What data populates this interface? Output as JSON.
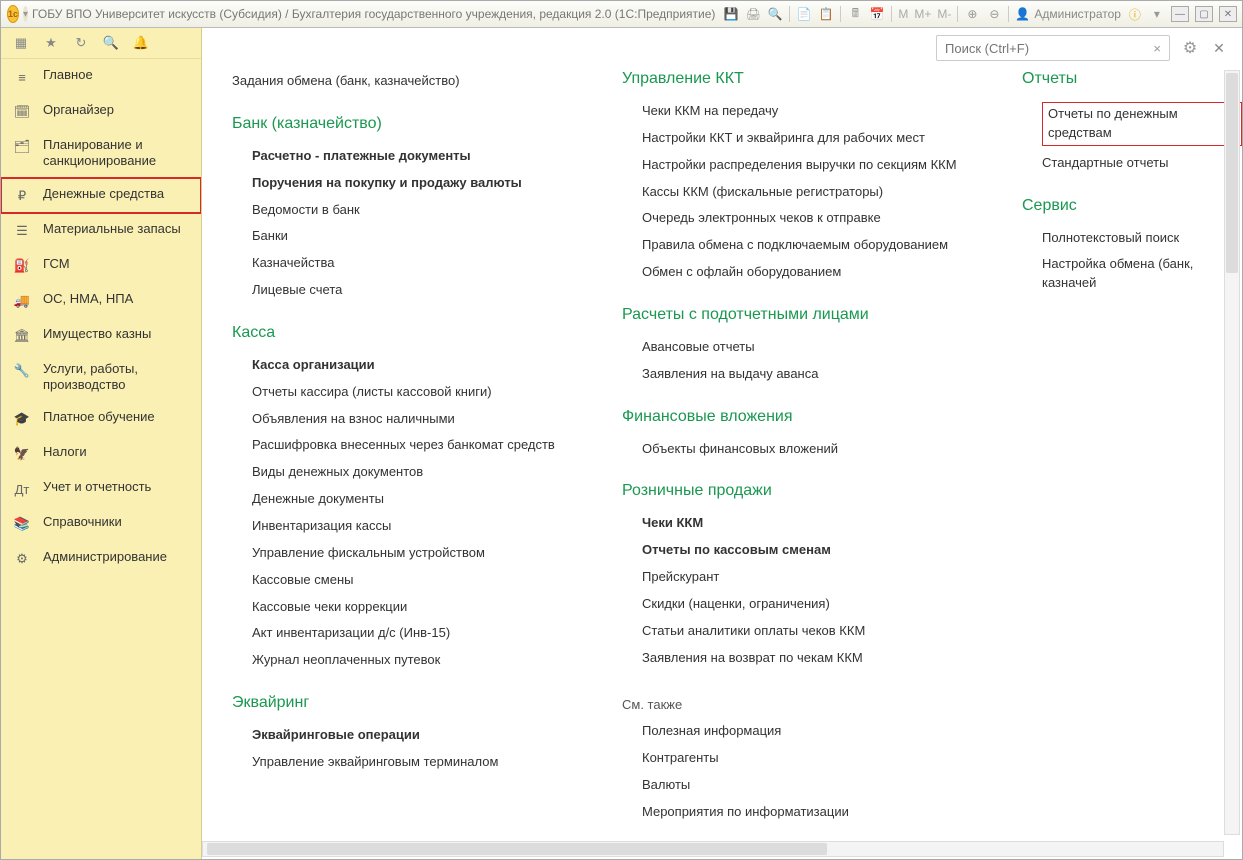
{
  "titlebar": {
    "title": "ГОБУ ВПО Университет искусств (Субсидия) / Бухгалтерия государственного учреждения, редакция 2.0  (1С:Предприятие)",
    "m": "M",
    "m_plus": "M+",
    "m_minus": "M-",
    "user_label": "Администратор"
  },
  "search": {
    "placeholder": "Поиск (Ctrl+F)"
  },
  "sidebar": {
    "items": [
      {
        "icon": "≡",
        "label": "Главное"
      },
      {
        "icon": "🗓",
        "label": "Органайзер"
      },
      {
        "icon": "🗂",
        "label": "Планирование и санкционирование"
      },
      {
        "icon": "₽",
        "label": "Денежные средства",
        "active": true
      },
      {
        "icon": "☰",
        "label": "Материальные запасы"
      },
      {
        "icon": "⛽",
        "label": "ГСМ"
      },
      {
        "icon": "🚚",
        "label": "ОС, НМА, НПА"
      },
      {
        "icon": "🏛",
        "label": "Имущество казны"
      },
      {
        "icon": "🔧",
        "label": "Услуги, работы, производство"
      },
      {
        "icon": "🎓",
        "label": "Платное обучение"
      },
      {
        "icon": "🦅",
        "label": "Налоги"
      },
      {
        "icon": "Дт",
        "label": "Учет и отчетность"
      },
      {
        "icon": "📚",
        "label": "Справочники"
      },
      {
        "icon": "⚙",
        "label": "Администрирование"
      }
    ]
  },
  "sections": {
    "col1": [
      {
        "items": [
          {
            "t": "Задания обмена (банк, казначейство)",
            "plain": true
          }
        ]
      },
      {
        "title": "Банк (казначейство)",
        "items": [
          {
            "t": "Расчетно - платежные документы",
            "b": true
          },
          {
            "t": "Поручения на покупку и продажу валюты",
            "b": true
          },
          {
            "t": "Ведомости в банк"
          },
          {
            "t": "Банки"
          },
          {
            "t": "Казначейства"
          },
          {
            "t": "Лицевые счета"
          }
        ]
      },
      {
        "title": "Касса",
        "items": [
          {
            "t": "Касса организации",
            "b": true
          },
          {
            "t": "Отчеты кассира (листы кассовой книги)"
          },
          {
            "t": "Объявления на взнос наличными"
          },
          {
            "t": "Расшифровка внесенных через банкомат средств"
          },
          {
            "t": "Виды денежных документов"
          },
          {
            "t": "Денежные документы"
          },
          {
            "t": "Инвентаризация кассы"
          },
          {
            "t": "Управление фискальным устройством"
          },
          {
            "t": "Кассовые смены"
          },
          {
            "t": "Кассовые чеки коррекции"
          },
          {
            "t": "Акт инвентаризации д/с (Инв-15)"
          },
          {
            "t": "Журнал неоплаченных путевок"
          }
        ]
      },
      {
        "title": "Эквайринг",
        "items": [
          {
            "t": "Эквайринговые операции",
            "b": true
          },
          {
            "t": "Управление эквайринговым терминалом"
          }
        ]
      }
    ],
    "col2": [
      {
        "title": "Управление ККТ",
        "first": true,
        "items": [
          {
            "t": "Чеки ККМ на передачу"
          },
          {
            "t": "Настройки ККТ и эквайринга для рабочих мест"
          },
          {
            "t": "Настройки распределения выручки по секциям ККМ"
          },
          {
            "t": "Кассы ККМ (фискальные регистраторы)"
          },
          {
            "t": "Очередь электронных чеков к отправке"
          },
          {
            "t": "Правила обмена с подключаемым оборудованием"
          },
          {
            "t": "Обмен с офлайн оборудованием"
          }
        ]
      },
      {
        "title": "Расчеты с подотчетными лицами",
        "items": [
          {
            "t": "Авансовые отчеты"
          },
          {
            "t": "Заявления на выдачу аванса"
          }
        ]
      },
      {
        "title": "Финансовые вложения",
        "items": [
          {
            "t": "Объекты финансовых вложений"
          }
        ]
      },
      {
        "title": "Розничные продажи",
        "items": [
          {
            "t": "Чеки ККМ",
            "b": true
          },
          {
            "t": "Отчеты по кассовым сменам",
            "b": true
          },
          {
            "t": "Прейскурант"
          },
          {
            "t": "Скидки (наценки, ограничения)"
          },
          {
            "t": "Статьи аналитики оплаты чеков ККМ"
          },
          {
            "t": "Заявления на возврат по чекам ККМ"
          }
        ]
      },
      {
        "see_also": "См. также",
        "items2": [
          {
            "t": "Полезная информация"
          },
          {
            "t": "Контрагенты"
          },
          {
            "t": "Валюты"
          },
          {
            "t": "Мероприятия по информатизации"
          }
        ]
      }
    ],
    "col3": [
      {
        "title": "Отчеты",
        "first": true,
        "items": [
          {
            "t": "Отчеты по денежным средствам",
            "hl": true
          },
          {
            "t": "Стандартные отчеты"
          }
        ]
      },
      {
        "title": "Сервис",
        "items": [
          {
            "t": "Полнотекстовый поиск"
          },
          {
            "t": "Настройка обмена (банк, казначей"
          }
        ]
      }
    ]
  }
}
